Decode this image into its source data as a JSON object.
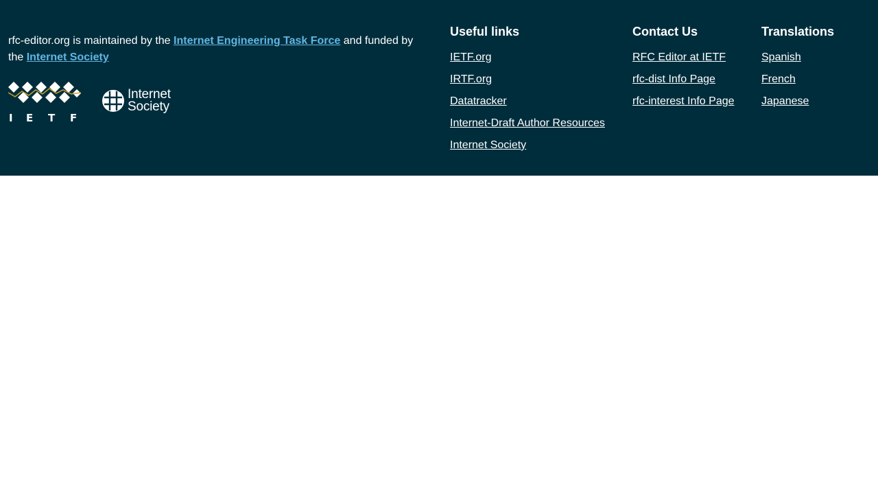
{
  "about": {
    "text_before": "rfc-editor.org is maintained by the ",
    "ietf_link": "Internet Engineering Task Force",
    "text_middle": " and funded by the ",
    "isoc_link": "Internet Society"
  },
  "logos": {
    "ietf_letters": [
      "I",
      "E",
      "T",
      "F"
    ],
    "isoc_line1": "Internet",
    "isoc_line2": "Society"
  },
  "useful_links": {
    "heading": "Useful links",
    "items": [
      "IETF.org",
      "IRTF.org",
      "Datatracker",
      "Internet-Draft Author Resources",
      "Internet Society"
    ]
  },
  "contact": {
    "heading": "Contact Us",
    "items": [
      "RFC Editor at IETF",
      "rfc-dist Info Page",
      "rfc-interest Info Page"
    ]
  },
  "translations": {
    "heading": "Translations",
    "items": [
      "Spanish",
      "French",
      "Japanese"
    ]
  },
  "colors": {
    "footer_bg": "#002d3c",
    "link_accent": "#62b5e2",
    "logo_gold": "#c9a227"
  }
}
